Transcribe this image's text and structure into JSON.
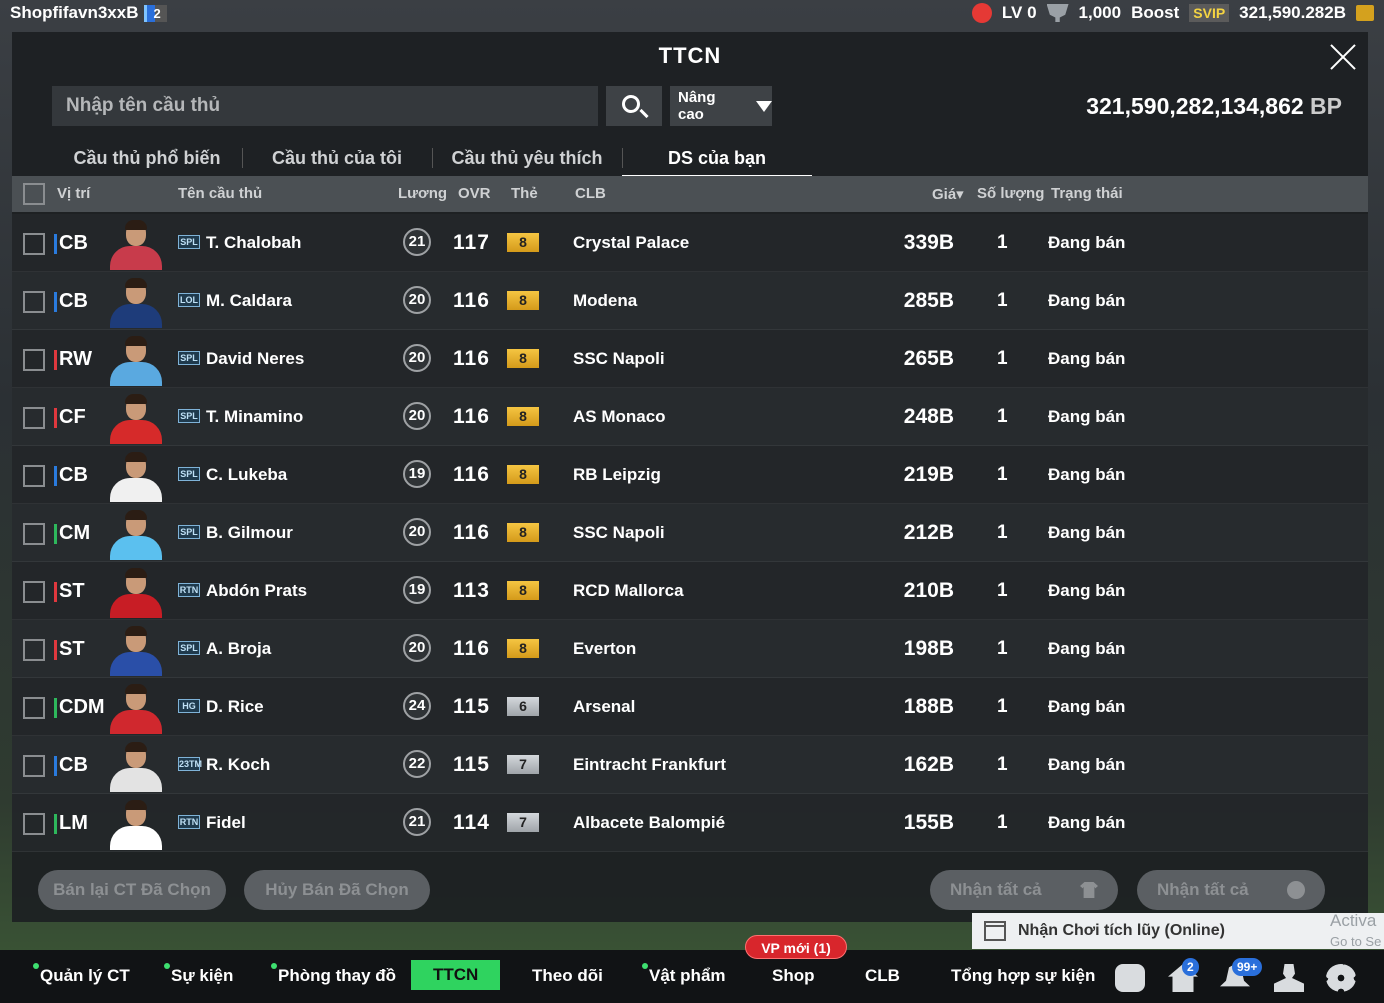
{
  "topbar": {
    "username": "Shopfifavn3xxB",
    "user_badge": "2",
    "lv_label": "LV 0",
    "trophy_value": "1,000",
    "boost_label": "Boost",
    "svip_label": "SVIP",
    "bp_short": "321,590.282B"
  },
  "window": {
    "title": "TTCN",
    "search_placeholder": "Nhập tên cầu thủ",
    "advanced_label": "Nâng cao",
    "bp_total": "321,590,282,134,862",
    "bp_unit": "BP"
  },
  "tabs": [
    {
      "label": "Cầu thủ phổ biến"
    },
    {
      "label": "Cầu thủ của tôi"
    },
    {
      "label": "Cầu thủ yêu thích"
    },
    {
      "label": "DS của bạn"
    }
  ],
  "table": {
    "headers": {
      "position": "Vị trí",
      "name": "Tên cầu thủ",
      "level": "Lương",
      "ovr": "OVR",
      "card": "Thẻ",
      "club": "CLB",
      "price": "Giá▾",
      "qty": "Số lượng",
      "status": "Trạng thái"
    },
    "rows": [
      {
        "pos": "CB",
        "season": "SPL",
        "name": "T. Chalobah",
        "level": "21",
        "ovr": "117",
        "card": "8",
        "club": "Crystal Palace",
        "price": "339B",
        "qty": "1",
        "status": "Đang bán"
      },
      {
        "pos": "CB",
        "season": "LOL",
        "name": "M. Caldara",
        "level": "20",
        "ovr": "116",
        "card": "8",
        "club": "Modena",
        "price": "285B",
        "qty": "1",
        "status": "Đang bán"
      },
      {
        "pos": "RW",
        "season": "SPL",
        "name": "David Neres",
        "level": "20",
        "ovr": "116",
        "card": "8",
        "club": "SSC Napoli",
        "price": "265B",
        "qty": "1",
        "status": "Đang bán"
      },
      {
        "pos": "CF",
        "season": "SPL",
        "name": "T. Minamino",
        "level": "20",
        "ovr": "116",
        "card": "8",
        "club": "AS Monaco",
        "price": "248B",
        "qty": "1",
        "status": "Đang bán"
      },
      {
        "pos": "CB",
        "season": "SPL",
        "name": "C. Lukeba",
        "level": "19",
        "ovr": "116",
        "card": "8",
        "club": "RB Leipzig",
        "price": "219B",
        "qty": "1",
        "status": "Đang bán"
      },
      {
        "pos": "CM",
        "season": "SPL",
        "name": "B. Gilmour",
        "level": "20",
        "ovr": "116",
        "card": "8",
        "club": "SSC Napoli",
        "price": "212B",
        "qty": "1",
        "status": "Đang bán"
      },
      {
        "pos": "ST",
        "season": "RTN",
        "name": "Abdón Prats",
        "level": "19",
        "ovr": "113",
        "card": "8",
        "club": "RCD Mallorca",
        "price": "210B",
        "qty": "1",
        "status": "Đang bán"
      },
      {
        "pos": "ST",
        "season": "SPL",
        "name": "A. Broja",
        "level": "20",
        "ovr": "116",
        "card": "8",
        "club": "Everton",
        "price": "198B",
        "qty": "1",
        "status": "Đang bán"
      },
      {
        "pos": "CDM",
        "season": "HG",
        "name": "D. Rice",
        "level": "24",
        "ovr": "115",
        "card": "6",
        "club": "Arsenal",
        "price": "188B",
        "qty": "1",
        "status": "Đang bán"
      },
      {
        "pos": "CB",
        "season": "23TM",
        "name": "R. Koch",
        "level": "22",
        "ovr": "115",
        "card": "7",
        "club": "Eintracht Frankfurt",
        "price": "162B",
        "qty": "1",
        "status": "Đang bán"
      },
      {
        "pos": "LM",
        "season": "RTN",
        "name": "Fidel",
        "level": "21",
        "ovr": "114",
        "card": "7",
        "club": "Albacete Balompié",
        "price": "155B",
        "qty": "1",
        "status": "Đang bán"
      }
    ]
  },
  "actions": {
    "resell_selected": "Bán lại CT Đã Chọn",
    "cancel_selected": "Hủy Bán Đã Chọn",
    "claim_all_1": "Nhận tất cả",
    "claim_all_2": "Nhận tất cả"
  },
  "notification": {
    "text": "Nhận Chơi tích lũy (Online)",
    "activate": "Activa",
    "goto": "Go to Se"
  },
  "bottom_nav": {
    "items": [
      "Quản lý CT",
      "Sự kiện",
      "Phòng thay đồ",
      "TTCN",
      "Theo dõi",
      "Vật phẩm",
      "Shop",
      "CLB",
      "Tổng hợp sự kiện"
    ],
    "vp_badge": "VP mới (1)",
    "home_badge": "2",
    "bell_badge": "99+"
  },
  "colors": {
    "accent_green": "#2fd35f",
    "card_gold": "#f5c542",
    "card_silver": "#c4c8cc",
    "pos_defender": "#2a7bde",
    "pos_attacker": "#e0383e",
    "pos_midfielder": "#2eb85c"
  }
}
